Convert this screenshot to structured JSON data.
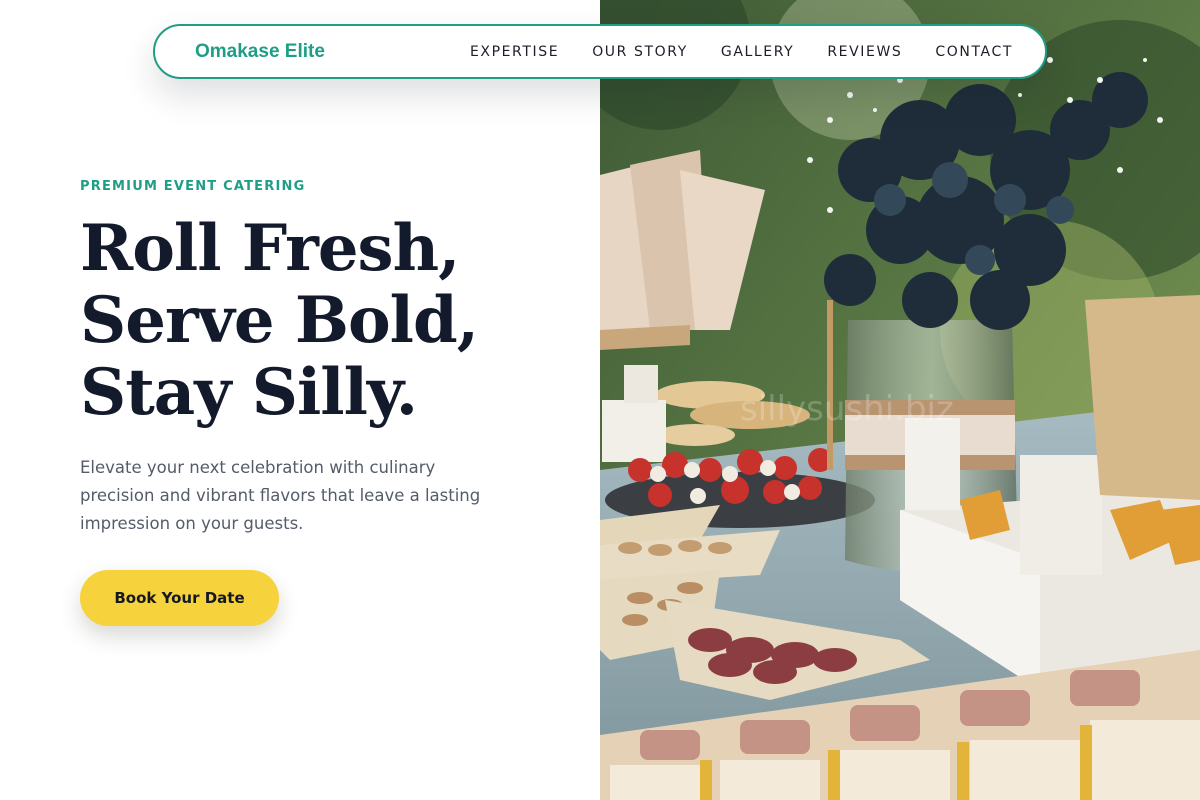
{
  "header": {
    "brand": "Omakase Elite",
    "nav": [
      {
        "label": "EXPERTISE"
      },
      {
        "label": "OUR STORY"
      },
      {
        "label": "GALLERY"
      },
      {
        "label": "REVIEWS"
      },
      {
        "label": "CONTACT"
      }
    ]
  },
  "hero": {
    "eyebrow": "PREMIUM EVENT CATERING",
    "headline": [
      "Roll Fresh,",
      "Serve Bold,",
      "Stay Silly."
    ],
    "description": "Elevate your next celebration with culinary precision and vibrant flavors that leave a lasting impression on your guests.",
    "cta_label": "Book Your Date",
    "image_watermark": "sillysushi.biz"
  },
  "colors": {
    "accent": "#1f9e85",
    "cta": "#f6d23d",
    "headline": "#131a2b",
    "body_text": "#545c6a"
  }
}
